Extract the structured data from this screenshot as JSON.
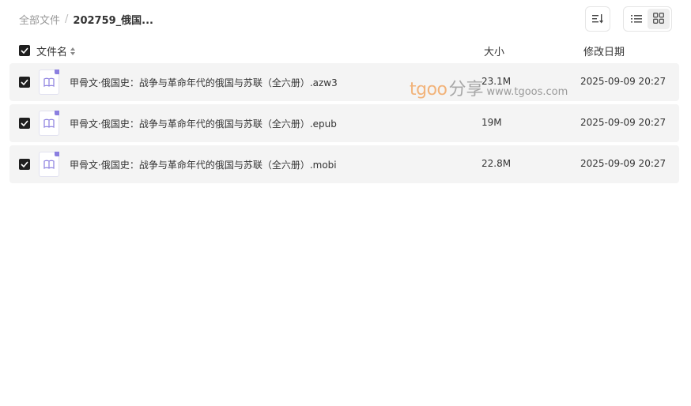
{
  "breadcrumb": {
    "root": "全部文件",
    "separator": "/",
    "current": "202759_俄国..."
  },
  "toolbar": {
    "sort_icon": "sort-icon",
    "list_view_icon": "list-view-icon",
    "grid_view_icon": "grid-view-icon"
  },
  "table": {
    "headers": {
      "name": "文件名",
      "size": "大小",
      "date": "修改日期"
    },
    "rows": [
      {
        "name": "甲骨文·俄国史：战争与革命年代的俄国与苏联（全六册）.azw3",
        "size": "23.1M",
        "date": "2025-09-09 20:27",
        "checked": true,
        "icon": "ebook-file-icon"
      },
      {
        "name": "甲骨文·俄国史：战争与革命年代的俄国与苏联（全六册）.epub",
        "size": "19M",
        "date": "2025-09-09 20:27",
        "checked": true,
        "icon": "ebook-file-icon"
      },
      {
        "name": "甲骨文·俄国史：战争与革命年代的俄国与苏联（全六册）.mobi",
        "size": "22.8M",
        "date": "2025-09-09 20:27",
        "checked": true,
        "icon": "ebook-file-icon"
      }
    ]
  },
  "watermark": {
    "brand": "tgoo",
    "share": "分享",
    "url": "www.tgoos.com"
  },
  "colors": {
    "row_bg": "#f4f4f4",
    "checkbox": "#1f1f1f",
    "icon_accent": "#8b7fe0",
    "watermark_brand": "#f2b37a"
  }
}
